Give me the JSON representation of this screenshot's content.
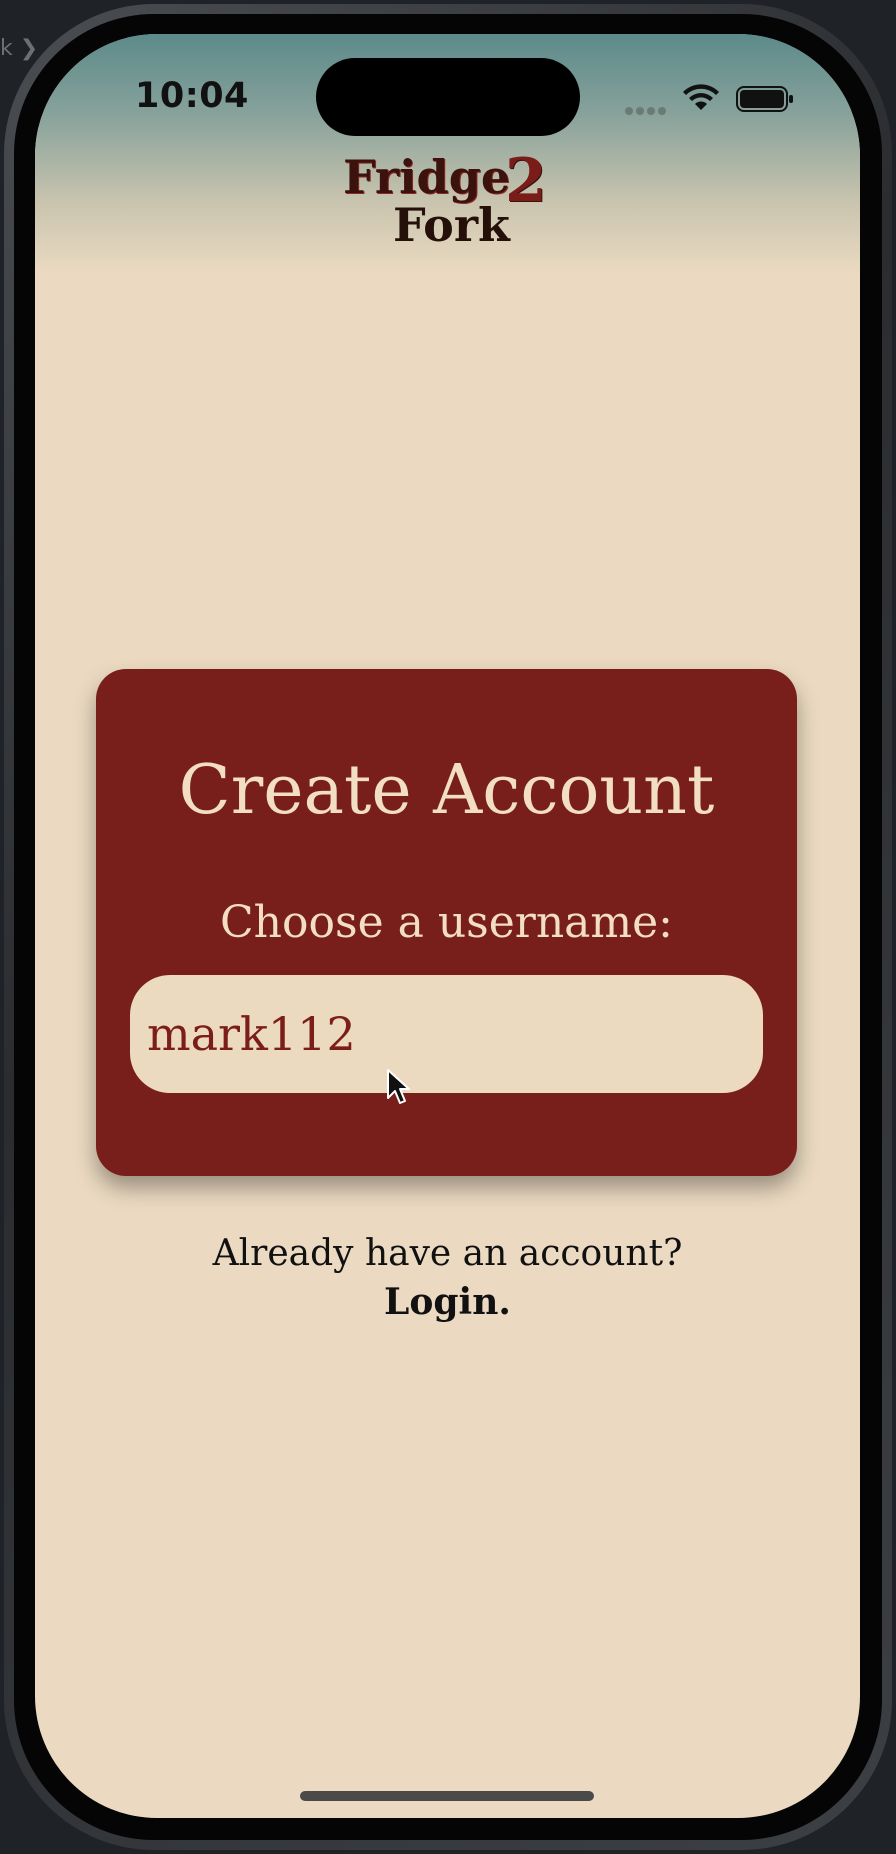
{
  "status_bar": {
    "time": "10:04"
  },
  "background": {
    "breadcrumb_fragment": "k ❯"
  },
  "logo": {
    "line1": "Fridge",
    "number": "2",
    "line2": "Fork"
  },
  "card": {
    "title": "Create Account",
    "label": "Choose a username:",
    "username_value": "mark112"
  },
  "footer": {
    "prompt": "Already have an account?",
    "login_label": "Login."
  },
  "colors": {
    "background": "#ebdac1",
    "card": "#791f1b",
    "card_text": "#f2dec0",
    "input_text": "#7b1e19"
  },
  "icons": {
    "signal": "cellular-signal-icon",
    "wifi": "wifi-icon",
    "battery": "battery-icon",
    "cursor": "mouse-pointer-icon"
  }
}
